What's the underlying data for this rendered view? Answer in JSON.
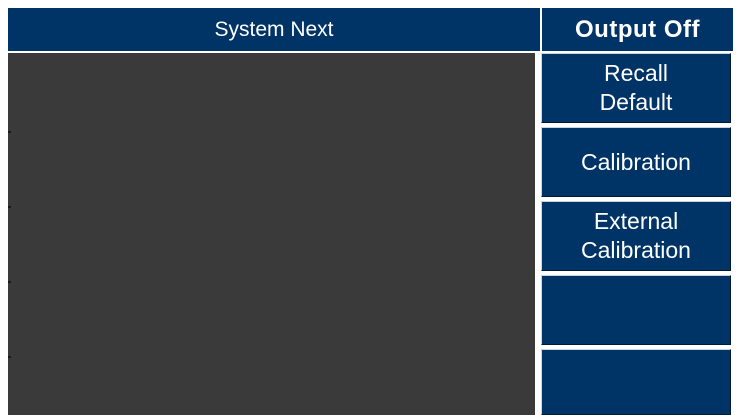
{
  "header": {
    "title": "System Next",
    "output_status": "Output Off"
  },
  "softkeys": [
    {
      "line1": "Recall",
      "line2": "Default"
    },
    {
      "line1": "Calibration",
      "line2": ""
    },
    {
      "line1": "External",
      "line2": "Calibration"
    },
    {
      "line1": "",
      "line2": ""
    },
    {
      "line1": "",
      "line2": ""
    }
  ],
  "colors": {
    "header_background": "#003366",
    "softkey_background": "#003366",
    "display_background": "#3a3a3a",
    "text": "#ffffff"
  }
}
